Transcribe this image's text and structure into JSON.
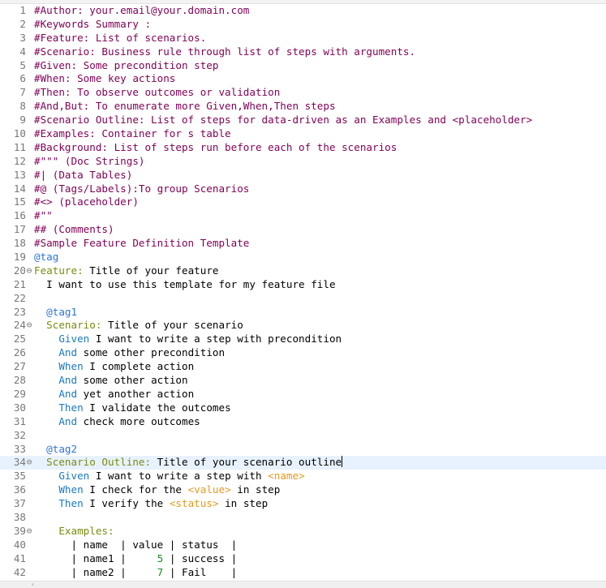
{
  "editor": {
    "lines": [
      {
        "n": "1",
        "fold": "",
        "segs": [
          {
            "t": "#Author: your.email@your.domain.com",
            "c": "comment"
          }
        ]
      },
      {
        "n": "2",
        "fold": "",
        "segs": [
          {
            "t": "#Keywords Summary :",
            "c": "comment"
          }
        ]
      },
      {
        "n": "3",
        "fold": "",
        "segs": [
          {
            "t": "#Feature: List of scenarios.",
            "c": "comment"
          }
        ]
      },
      {
        "n": "4",
        "fold": "",
        "segs": [
          {
            "t": "#Scenario: Business rule through list of steps with arguments.",
            "c": "comment"
          }
        ]
      },
      {
        "n": "5",
        "fold": "",
        "segs": [
          {
            "t": "#Given: Some precondition step",
            "c": "comment"
          }
        ]
      },
      {
        "n": "6",
        "fold": "",
        "segs": [
          {
            "t": "#When: Some key actions",
            "c": "comment"
          }
        ]
      },
      {
        "n": "7",
        "fold": "",
        "segs": [
          {
            "t": "#Then: To observe outcomes or validation",
            "c": "comment"
          }
        ]
      },
      {
        "n": "8",
        "fold": "",
        "segs": [
          {
            "t": "#And,But: To enumerate more Given,When,Then steps",
            "c": "comment"
          }
        ]
      },
      {
        "n": "9",
        "fold": "",
        "segs": [
          {
            "t": "#Scenario Outline: List of steps for data-driven as an Examples and <placeholder>",
            "c": "comment"
          }
        ]
      },
      {
        "n": "10",
        "fold": "",
        "segs": [
          {
            "t": "#Examples: Container for s table",
            "c": "comment"
          }
        ]
      },
      {
        "n": "11",
        "fold": "",
        "segs": [
          {
            "t": "#Background: List of steps run before each of the scenarios",
            "c": "comment"
          }
        ]
      },
      {
        "n": "12",
        "fold": "",
        "segs": [
          {
            "t": "#\"\"\" (Doc Strings)",
            "c": "comment"
          }
        ]
      },
      {
        "n": "13",
        "fold": "",
        "segs": [
          {
            "t": "#| (Data Tables)",
            "c": "comment"
          }
        ]
      },
      {
        "n": "14",
        "fold": "",
        "segs": [
          {
            "t": "#@ (Tags/Labels):To group Scenarios",
            "c": "comment"
          }
        ]
      },
      {
        "n": "15",
        "fold": "",
        "segs": [
          {
            "t": "#<> (placeholder)",
            "c": "comment"
          }
        ]
      },
      {
        "n": "16",
        "fold": "",
        "segs": [
          {
            "t": "#\"\"",
            "c": "comment"
          }
        ]
      },
      {
        "n": "17",
        "fold": "",
        "segs": [
          {
            "t": "## (Comments)",
            "c": "comment"
          }
        ]
      },
      {
        "n": "18",
        "fold": "",
        "segs": [
          {
            "t": "#Sample Feature Definition Template",
            "c": "comment"
          }
        ]
      },
      {
        "n": "19",
        "fold": "",
        "segs": [
          {
            "t": "@tag",
            "c": "tag"
          }
        ]
      },
      {
        "n": "20",
        "fold": "⊖",
        "segs": [
          {
            "t": "Feature:",
            "c": "keyword"
          },
          {
            "t": " Title of your feature",
            "c": "plain"
          }
        ]
      },
      {
        "n": "21",
        "fold": "",
        "segs": [
          {
            "t": "  I want to use this template for my feature file",
            "c": "plain"
          }
        ]
      },
      {
        "n": "22",
        "fold": "",
        "segs": []
      },
      {
        "n": "23",
        "fold": "",
        "segs": [
          {
            "t": "  ",
            "c": "plain"
          },
          {
            "t": "@tag1",
            "c": "tag"
          }
        ]
      },
      {
        "n": "24",
        "fold": "⊖",
        "segs": [
          {
            "t": "  ",
            "c": "plain"
          },
          {
            "t": "Scenario:",
            "c": "keyword"
          },
          {
            "t": " Title of your scenario",
            "c": "plain"
          }
        ]
      },
      {
        "n": "25",
        "fold": "",
        "segs": [
          {
            "t": "    ",
            "c": "plain"
          },
          {
            "t": "Given",
            "c": "step"
          },
          {
            "t": " I want to write a step with precondition",
            "c": "plain"
          }
        ]
      },
      {
        "n": "26",
        "fold": "",
        "segs": [
          {
            "t": "    ",
            "c": "plain"
          },
          {
            "t": "And",
            "c": "step"
          },
          {
            "t": " some other precondition",
            "c": "plain"
          }
        ]
      },
      {
        "n": "27",
        "fold": "",
        "segs": [
          {
            "t": "    ",
            "c": "plain"
          },
          {
            "t": "When",
            "c": "step"
          },
          {
            "t": " I complete action",
            "c": "plain"
          }
        ]
      },
      {
        "n": "28",
        "fold": "",
        "segs": [
          {
            "t": "    ",
            "c": "plain"
          },
          {
            "t": "And",
            "c": "step"
          },
          {
            "t": " some other action",
            "c": "plain"
          }
        ]
      },
      {
        "n": "29",
        "fold": "",
        "segs": [
          {
            "t": "    ",
            "c": "plain"
          },
          {
            "t": "And",
            "c": "step"
          },
          {
            "t": " yet another action",
            "c": "plain"
          }
        ]
      },
      {
        "n": "30",
        "fold": "",
        "segs": [
          {
            "t": "    ",
            "c": "plain"
          },
          {
            "t": "Then",
            "c": "step"
          },
          {
            "t": " I validate the outcomes",
            "c": "plain"
          }
        ]
      },
      {
        "n": "31",
        "fold": "",
        "segs": [
          {
            "t": "    ",
            "c": "plain"
          },
          {
            "t": "And",
            "c": "step"
          },
          {
            "t": " check more outcomes",
            "c": "plain"
          }
        ]
      },
      {
        "n": "32",
        "fold": "",
        "segs": []
      },
      {
        "n": "33",
        "fold": "",
        "segs": [
          {
            "t": "  ",
            "c": "plain"
          },
          {
            "t": "@tag2",
            "c": "tag"
          }
        ]
      },
      {
        "n": "34",
        "fold": "⊖",
        "current": true,
        "segs": [
          {
            "t": "  ",
            "c": "plain"
          },
          {
            "t": "Scenario Outline:",
            "c": "keyword"
          },
          {
            "t": " Title of your scenario outline",
            "c": "plain"
          }
        ]
      },
      {
        "n": "35",
        "fold": "",
        "segs": [
          {
            "t": "    ",
            "c": "plain"
          },
          {
            "t": "Given",
            "c": "step"
          },
          {
            "t": " I want to write a step with ",
            "c": "plain"
          },
          {
            "t": "<name>",
            "c": "placeholder"
          }
        ]
      },
      {
        "n": "36",
        "fold": "",
        "segs": [
          {
            "t": "    ",
            "c": "plain"
          },
          {
            "t": "When",
            "c": "step"
          },
          {
            "t": " I check for the ",
            "c": "plain"
          },
          {
            "t": "<value>",
            "c": "placeholder"
          },
          {
            "t": " in step",
            "c": "plain"
          }
        ]
      },
      {
        "n": "37",
        "fold": "",
        "segs": [
          {
            "t": "    ",
            "c": "plain"
          },
          {
            "t": "Then",
            "c": "step"
          },
          {
            "t": " I verify the ",
            "c": "plain"
          },
          {
            "t": "<status>",
            "c": "placeholder"
          },
          {
            "t": " in step",
            "c": "plain"
          }
        ]
      },
      {
        "n": "38",
        "fold": "",
        "segs": []
      },
      {
        "n": "39",
        "fold": "⊖",
        "segs": [
          {
            "t": "    ",
            "c": "plain"
          },
          {
            "t": "Examples:",
            "c": "keyword"
          }
        ]
      },
      {
        "n": "40",
        "fold": "",
        "segs": [
          {
            "t": "      | name  | value | status  |",
            "c": "plain"
          }
        ]
      },
      {
        "n": "41",
        "fold": "",
        "segs": [
          {
            "t": "      | name1 |     ",
            "c": "plain"
          },
          {
            "t": "5",
            "c": "number"
          },
          {
            "t": " | success |",
            "c": "plain"
          }
        ]
      },
      {
        "n": "42",
        "fold": "",
        "segs": [
          {
            "t": "      | name2 |     ",
            "c": "plain"
          },
          {
            "t": "7",
            "c": "number"
          },
          {
            "t": " | Fail    |",
            "c": "plain"
          }
        ]
      }
    ]
  }
}
